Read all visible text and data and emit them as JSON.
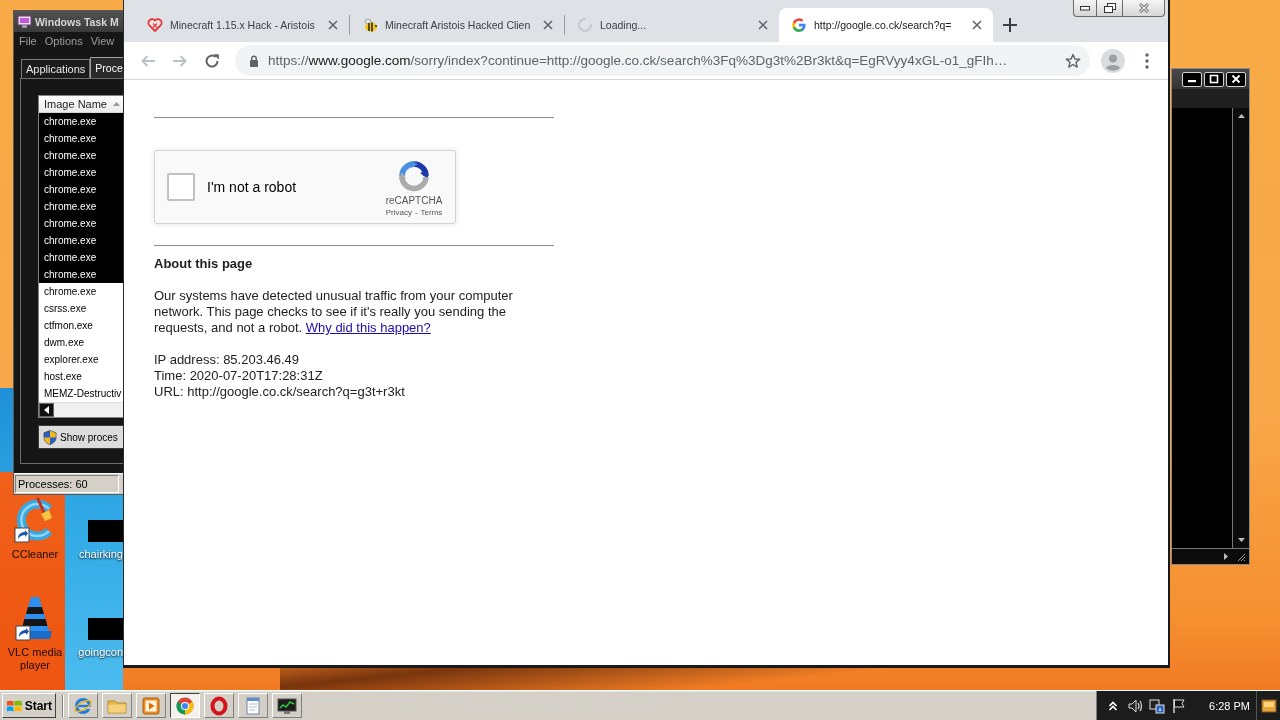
{
  "desktop": {
    "icons": [
      {
        "label": "CCleaner",
        "kind": "ccleaner"
      },
      {
        "label": "chairking",
        "kind": "blank"
      },
      {
        "label": "VLC media player",
        "kind": "vlc"
      },
      {
        "label": "goingcon",
        "kind": "blank"
      }
    ]
  },
  "task_manager": {
    "title": "Windows Task M",
    "menu": [
      "File",
      "Options",
      "View"
    ],
    "tabs": [
      {
        "label": "Applications",
        "selected": false
      },
      {
        "label": "Proce",
        "selected": true
      }
    ],
    "column": "Image Name",
    "rows": [
      {
        "name": "chrome.exe",
        "selected": true
      },
      {
        "name": "chrome.exe",
        "selected": true
      },
      {
        "name": "chrome.exe",
        "selected": true
      },
      {
        "name": "chrome.exe",
        "selected": true
      },
      {
        "name": "chrome.exe",
        "selected": true
      },
      {
        "name": "chrome.exe",
        "selected": true
      },
      {
        "name": "chrome.exe",
        "selected": true
      },
      {
        "name": "chrome.exe",
        "selected": true
      },
      {
        "name": "chrome.exe",
        "selected": true
      },
      {
        "name": "chrome.exe",
        "selected": true
      },
      {
        "name": "chrome.exe",
        "selected": false
      },
      {
        "name": "csrss.exe",
        "selected": false
      },
      {
        "name": "ctfmon.exe",
        "selected": false
      },
      {
        "name": "dwm.exe",
        "selected": false
      },
      {
        "name": "explorer.exe",
        "selected": false
      },
      {
        "name": "host.exe",
        "selected": false
      },
      {
        "name": "MEMZ-Destructiv",
        "selected": false
      }
    ],
    "button": "Show proces",
    "status": "Processes: 60"
  },
  "browser": {
    "tabs": [
      {
        "title": "Minecraft 1.15.x Hack - Aristois",
        "kind": "heart",
        "selected": false
      },
      {
        "title": "Minecraft Aristois Hacked Clien",
        "kind": "bee",
        "selected": false
      },
      {
        "title": "Loading...",
        "kind": "loading",
        "selected": false
      },
      {
        "title": "http://google.co.ck/search?q=",
        "kind": "google",
        "selected": true
      }
    ],
    "back": {
      "disabled": true
    },
    "forward": {
      "disabled": true
    },
    "url": "https://**www.google.com**/sorry/index?continue=http://google.co.ck/search%3Fq%3Dg3t%2Br3kt&q=EgRVyy4xGL-o1_gFIh…"
  },
  "page": {
    "captcha": {
      "label": "I'm not a robot",
      "checked": false,
      "brand": "reCAPTCHA",
      "links": [
        "Privacy",
        "Terms"
      ],
      "separator": "-"
    },
    "heading": "About this page",
    "paragraph": "Our systems have detected unusual traffic from your computer network. This page checks to see if it's really you sending the requests, and not a robot.",
    "link": "Why did this happen?",
    "details": [
      "IP address: 85.203.46.49",
      "Time: 2020-07-20T17:28:31Z",
      "URL: http://google.co.ck/search?q=g3t+r3kt"
    ]
  },
  "taskbar": {
    "start": "Start",
    "items": [
      {
        "kind": "ie",
        "selected": false
      },
      {
        "kind": "folder",
        "selected": false
      },
      {
        "kind": "media",
        "selected": false
      },
      {
        "kind": "chrome",
        "selected": true
      },
      {
        "kind": "opera",
        "selected": false
      },
      {
        "kind": "notepad",
        "selected": false
      },
      {
        "kind": "taskmgr",
        "selected": false
      }
    ],
    "clock": "6:28 PM"
  }
}
